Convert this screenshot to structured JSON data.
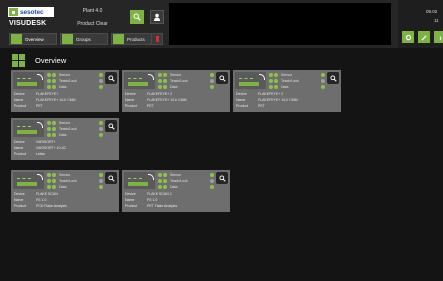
{
  "header": {
    "brand": "sesotec",
    "app_name": "VISUDESK",
    "plant": "Plant 4.0",
    "product": "Product Clear",
    "date": "09.02",
    "time": "11",
    "accent": "#7cb342"
  },
  "nav": {
    "overview_label": "Overview",
    "groups_label": "Groups",
    "products_label": "Products"
  },
  "page": {
    "title": "Overview"
  },
  "card_labels": {
    "status": [
      "Sensor",
      "Teach/Lock",
      "Data"
    ],
    "fields": [
      "Device",
      "Name",
      "Product"
    ]
  },
  "cards": [
    {
      "device": "FLAKEFEYE+",
      "name": "FLAKEFEYE+ 10-II CMM",
      "product": "PET"
    },
    {
      "device": "FLAKEFEYE+ 2",
      "name": "FLAKEFEYE+ 10-II CMM",
      "product": "PET"
    },
    {
      "device": "FLAKEFEYE+ 2",
      "name": "FLAKEFEYE+ 10-II CMM",
      "product": "PET"
    },
    {
      "device": "VARISORT+",
      "name": "VARISORT+ 10-IIC",
      "product": "Lettia"
    },
    {
      "device": "FLAKE SCAN",
      "name": "FS 1.0",
      "product": "PCD Flake Analysis"
    },
    {
      "device": "FLAKE SCAN 2",
      "name": "FS 1.0",
      "product": "PET Flake Analysis"
    }
  ]
}
